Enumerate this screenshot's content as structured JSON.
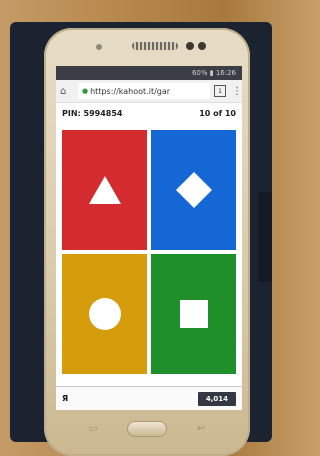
{
  "status_bar": {
    "text": "60% ▮ 16:26"
  },
  "browser": {
    "home_icon": "home-icon",
    "url": "https://kahoot.it/gar",
    "tab_count": "1",
    "menu_icon": "more-vert-icon"
  },
  "game": {
    "pin": "PIN: 5994854",
    "progress": "10 of 10",
    "answers": [
      {
        "shape": "triangle",
        "color": "#d42b2e"
      },
      {
        "shape": "diamond",
        "color": "#1567d6"
      },
      {
        "shape": "circle",
        "color": "#d59c0c"
      },
      {
        "shape": "square",
        "color": "#1f8f2a"
      }
    ],
    "player_name": "Я",
    "score": "4,014"
  }
}
